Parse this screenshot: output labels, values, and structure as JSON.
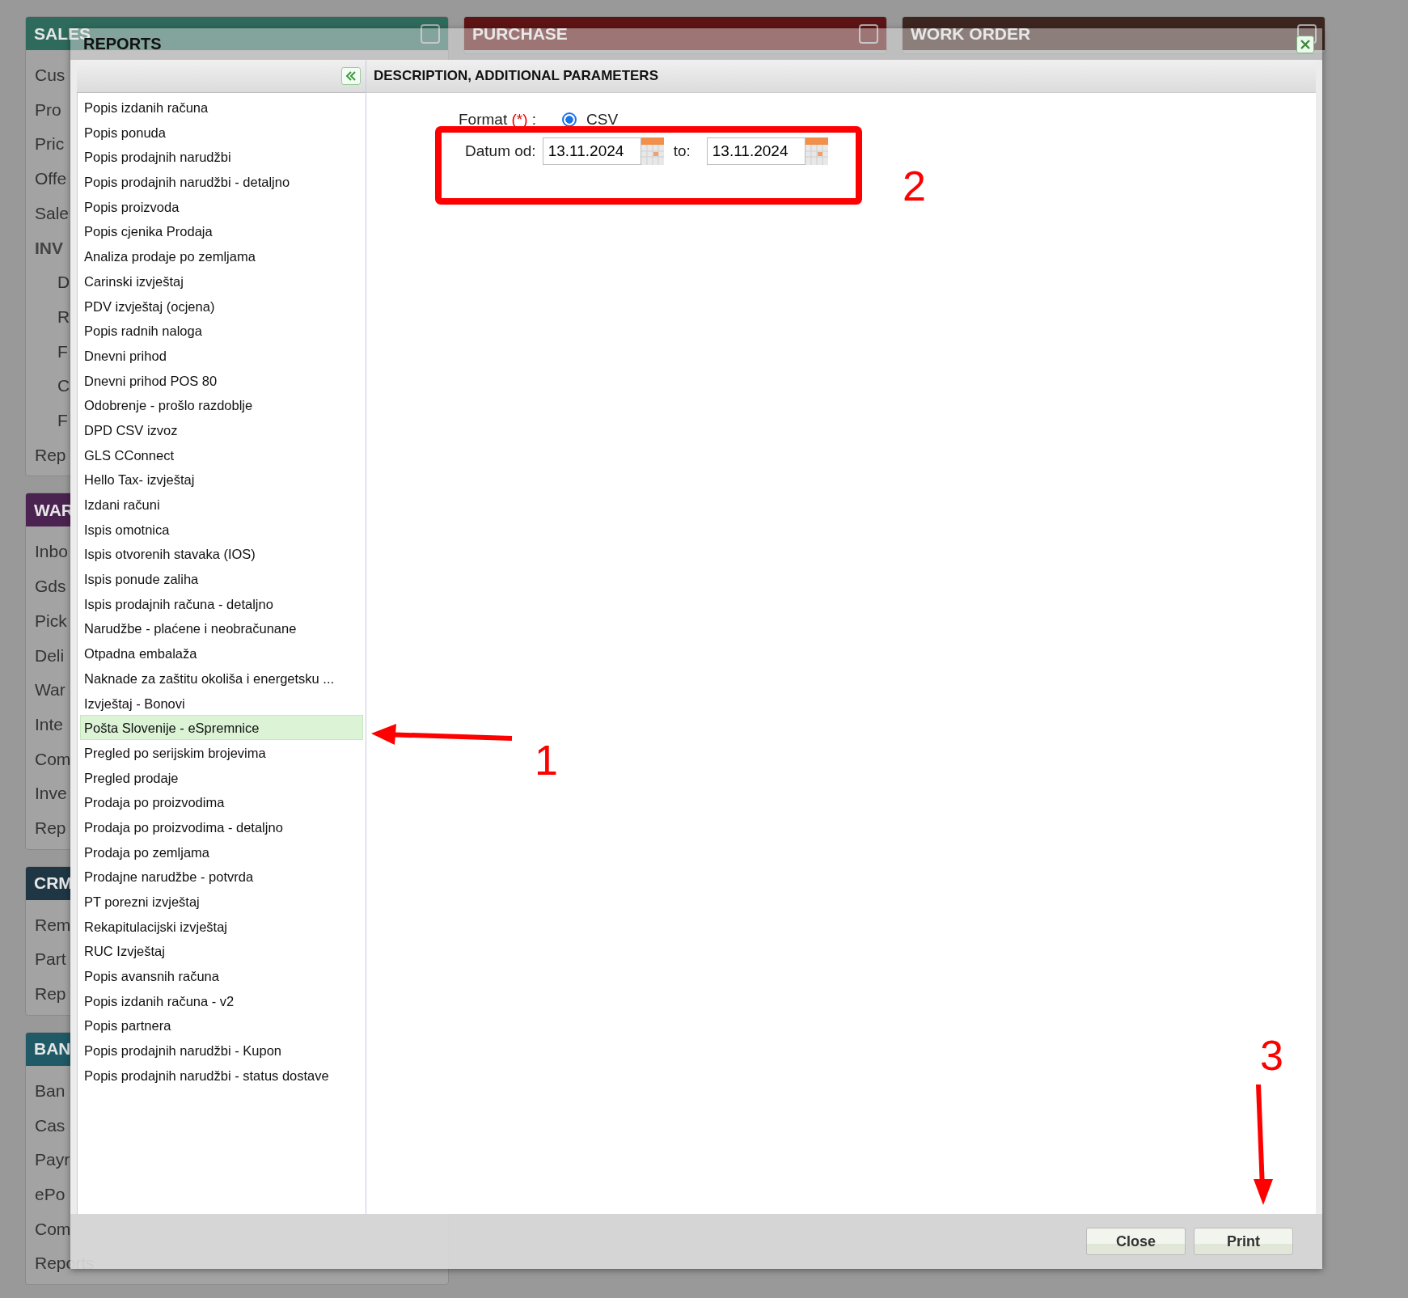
{
  "background": {
    "columns": [
      {
        "cards": [
          {
            "title": "SALES",
            "color": "#2e6b5c",
            "items": [
              {
                "label": "Cus",
                "kind": "item"
              },
              {
                "label": "Pro",
                "kind": "item"
              },
              {
                "label": "Pric",
                "kind": "item"
              },
              {
                "label": "Offe",
                "kind": "item"
              },
              {
                "label": "Sale",
                "kind": "item"
              },
              {
                "label": "INV",
                "kind": "heading"
              },
              {
                "label": "D",
                "kind": "sub"
              },
              {
                "label": "R",
                "kind": "sub"
              },
              {
                "label": "F",
                "kind": "sub"
              },
              {
                "label": "C",
                "kind": "sub"
              },
              {
                "label": "F",
                "kind": "sub"
              },
              {
                "label": "Rep",
                "kind": "item"
              }
            ]
          },
          {
            "title": "WAR",
            "color": "#4a2350",
            "items": [
              {
                "label": "Inbo",
                "kind": "item"
              },
              {
                "label": "Gds",
                "kind": "item"
              },
              {
                "label": "Pick",
                "kind": "item"
              },
              {
                "label": "Deli",
                "kind": "item"
              },
              {
                "label": "War",
                "kind": "item"
              },
              {
                "label": "Inte",
                "kind": "item"
              },
              {
                "label": "Com",
                "kind": "item"
              },
              {
                "label": "Inve",
                "kind": "item"
              },
              {
                "label": "Rep",
                "kind": "item"
              }
            ]
          },
          {
            "title": "CRM",
            "color": "#1f3645",
            "items": [
              {
                "label": "Rem",
                "kind": "item"
              },
              {
                "label": "Part",
                "kind": "item"
              },
              {
                "label": "Rep",
                "kind": "item"
              }
            ]
          },
          {
            "title": "BAN",
            "color": "#1f5a66",
            "items": [
              {
                "label": "Ban",
                "kind": "item"
              },
              {
                "label": "Cas",
                "kind": "item"
              },
              {
                "label": "Payr",
                "kind": "item"
              },
              {
                "label": "ePo",
                "kind": "item"
              },
              {
                "label": "Com",
                "kind": "item"
              },
              {
                "label": "Reports",
                "kind": "item"
              }
            ]
          }
        ]
      },
      {
        "cards": [
          {
            "title": "PURCHASE",
            "color": "#5e1414"
          }
        ]
      },
      {
        "cards": [
          {
            "title": "WORK ORDER",
            "color": "#3e2620"
          }
        ]
      }
    ]
  },
  "dialog": {
    "title": "REPORTS",
    "reports": [
      {
        "label": "Popis izdanih računa",
        "selected": false
      },
      {
        "label": "Popis ponuda",
        "selected": false
      },
      {
        "label": "Popis prodajnih narudžbi",
        "selected": false
      },
      {
        "label": "Popis prodajnih narudžbi - detaljno",
        "selected": false
      },
      {
        "label": "Popis proizvoda",
        "selected": false
      },
      {
        "label": "Popis cjenika Prodaja",
        "selected": false
      },
      {
        "label": "Analiza prodaje po zemljama",
        "selected": false
      },
      {
        "label": "Carinski izvještaj",
        "selected": false
      },
      {
        "label": "PDV izvještaj (ocjena)",
        "selected": false
      },
      {
        "label": "Popis radnih naloga",
        "selected": false
      },
      {
        "label": "Dnevni prihod",
        "selected": false
      },
      {
        "label": "Dnevni prihod POS 80",
        "selected": false
      },
      {
        "label": "Odobrenje - prošlo razdoblje",
        "selected": false
      },
      {
        "label": "DPD CSV izvoz",
        "selected": false
      },
      {
        "label": "GLS CConnect",
        "selected": false
      },
      {
        "label": "Hello Tax- izvještaj",
        "selected": false
      },
      {
        "label": "Izdani računi",
        "selected": false
      },
      {
        "label": "Ispis omotnica",
        "selected": false
      },
      {
        "label": "Ispis otvorenih stavaka (IOS)",
        "selected": false
      },
      {
        "label": "Ispis ponude zaliha",
        "selected": false
      },
      {
        "label": "Ispis prodajnih računa - detaljno",
        "selected": false
      },
      {
        "label": "Narudžbe - plaćene i neobračunane",
        "selected": false
      },
      {
        "label": "Otpadna embalaža",
        "selected": false
      },
      {
        "label": "Naknade za zaštitu okoliša i energetsku ...",
        "selected": false
      },
      {
        "label": "Izvještaj - Bonovi",
        "selected": false
      },
      {
        "label": "Pošta Slovenije - eSpremnice",
        "selected": true
      },
      {
        "label": "Pregled po serijskim brojevima",
        "selected": false
      },
      {
        "label": "Pregled prodaje",
        "selected": false
      },
      {
        "label": "Prodaja po proizvodima",
        "selected": false
      },
      {
        "label": "Prodaja po proizvodima - detaljno",
        "selected": false
      },
      {
        "label": "Prodaja po zemljama",
        "selected": false
      },
      {
        "label": "Prodajne narudžbe - potvrda",
        "selected": false
      },
      {
        "label": "PT porezni izvještaj",
        "selected": false
      },
      {
        "label": "Rekapitulacijski izvještaj",
        "selected": false
      },
      {
        "label": "RUC Izvještaj",
        "selected": false
      },
      {
        "label": "Popis avansnih računa",
        "selected": false
      },
      {
        "label": "Popis izdanih računa - v2",
        "selected": false
      },
      {
        "label": "Popis partnera",
        "selected": false
      },
      {
        "label": "Popis prodajnih narudžbi - Kupon",
        "selected": false
      },
      {
        "label": "Popis prodajnih narudžbi - status dostave",
        "selected": false
      }
    ],
    "params_title": "DESCRIPTION, ADDITIONAL PARAMETERS",
    "format": {
      "label": "Format",
      "required_mark": "(*)",
      "separator": ":",
      "option": "CSV",
      "selected": true
    },
    "date_from": {
      "label": "Datum od:",
      "value": "13.11.2024"
    },
    "date_to": {
      "label": "to:",
      "value": "13.11.2024"
    },
    "buttons": [
      "Close",
      "Print"
    ]
  },
  "annotations": [
    {
      "kind": "arrow",
      "label": "1"
    },
    {
      "kind": "box",
      "label": "2"
    },
    {
      "kind": "arrow",
      "label": "3"
    }
  ]
}
